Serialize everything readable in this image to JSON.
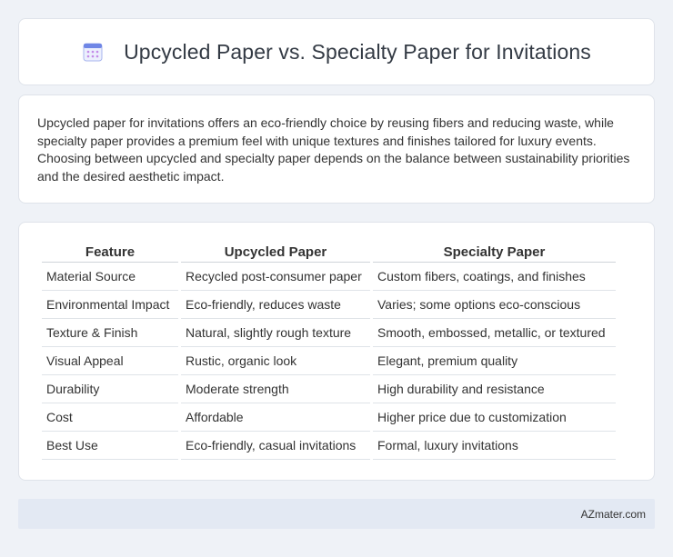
{
  "header": {
    "title": "Upcycled Paper vs. Specialty Paper for Invitations",
    "icon": "calendar-icon",
    "icon_color": "#7b8fe0"
  },
  "intro": {
    "text": "Upcycled paper for invitations offers an eco-friendly choice by reusing fibers and reducing waste, while specialty paper provides a premium feel with unique textures and finishes tailored for luxury events. Choosing between upcycled and specialty paper depends on the balance between sustainability priorities and the desired aesthetic impact."
  },
  "table": {
    "headers": [
      "Feature",
      "Upcycled Paper",
      "Specialty Paper"
    ],
    "rows": [
      [
        "Material Source",
        "Recycled post-consumer paper",
        "Custom fibers, coatings, and finishes"
      ],
      [
        "Environmental Impact",
        "Eco-friendly, reduces waste",
        "Varies; some options eco-conscious"
      ],
      [
        "Texture & Finish",
        "Natural, slightly rough texture",
        "Smooth, embossed, metallic, or textured"
      ],
      [
        "Visual Appeal",
        "Rustic, organic look",
        "Elegant, premium quality"
      ],
      [
        "Durability",
        "Moderate strength",
        "High durability and resistance"
      ],
      [
        "Cost",
        "Affordable",
        "Higher price due to customization"
      ],
      [
        "Best Use",
        "Eco-friendly, casual invitations",
        "Formal, luxury invitations"
      ]
    ]
  },
  "footer": {
    "text": "AZmater.com"
  }
}
